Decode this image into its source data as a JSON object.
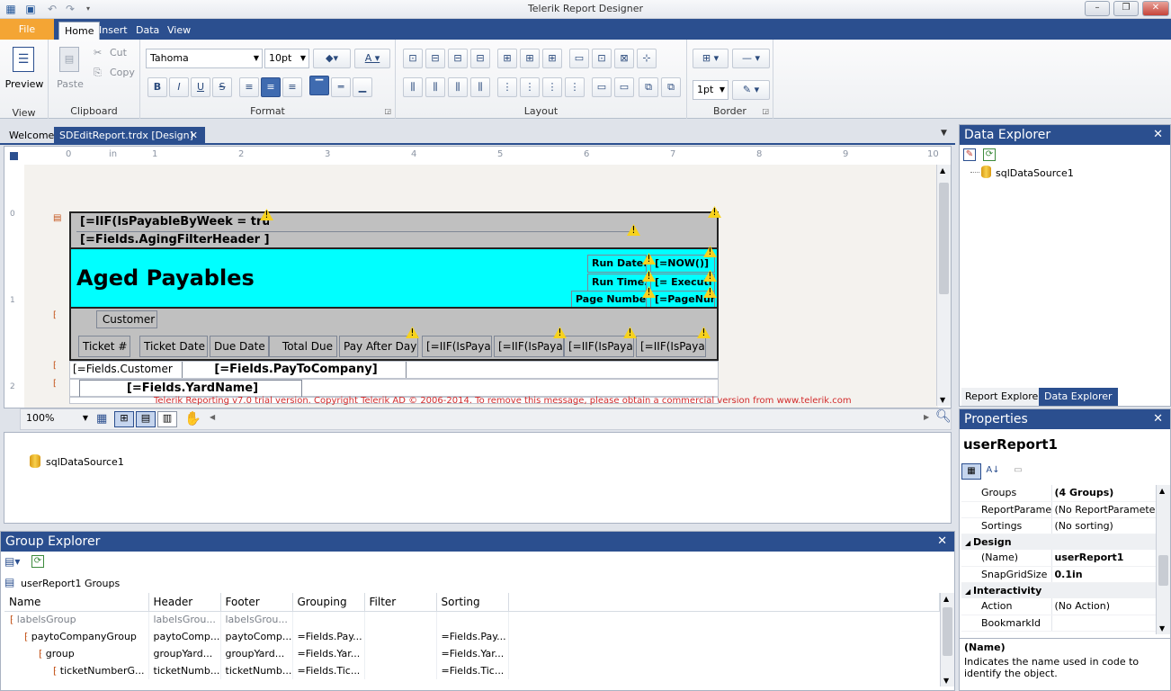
{
  "window": {
    "title": "Telerik Report Designer"
  },
  "ribbon": {
    "tabs": {
      "file": "File",
      "home": "Home",
      "insert": "Insert",
      "data": "Data",
      "view": "View"
    },
    "view_group": {
      "preview": "Preview",
      "label": "View"
    },
    "clipboard": {
      "paste": "Paste",
      "cut": "Cut",
      "copy": "Copy",
      "label": "Clipboard"
    },
    "format": {
      "font": "Tahoma",
      "size": "10pt",
      "label": "Format"
    },
    "layout": {
      "label": "Layout"
    },
    "border": {
      "width": "1pt",
      "label": "Border"
    }
  },
  "doc_tabs": {
    "welcome": "Welcome",
    "active": "SDEditReport.trdx [Design]"
  },
  "ruler": {
    "marks": [
      "0",
      "in",
      "1",
      "2",
      "3",
      "4",
      "5",
      "6",
      "7",
      "8",
      "9",
      "10"
    ]
  },
  "report": {
    "header_expr": "[=IIF(IsPayableByWeek = true",
    "aging_filter": "[=Fields.AgingFilterHeader ]",
    "title": "Aged Payables",
    "run_date_label": "Run Date:",
    "run_date_value": "[=NOW()]",
    "run_time_label": "Run Time:",
    "run_time_value": "[= Executi",
    "page_number_label": "Page Number:",
    "page_number_value": "[=PageNum",
    "customer_header": "Customer",
    "columns": [
      "Ticket #",
      "Ticket Date",
      "Due Date",
      "Total Due",
      "Pay After Day",
      "[=IIF(IsPaya",
      "[=IIF(IsPaya",
      "[=IIF(IsPaya",
      "[=IIF(IsPaya"
    ],
    "customer_field": "[=Fields.Customer",
    "pay_to_company": "[=Fields.PayToCompany]",
    "yard_name": "[=Fields.YardName]",
    "trial_notice": "Telerik Reporting v7.0 trial version. Copyright Telerik AD © 2006-2014. To remove this message, please obtain a commercial version from www.telerik.com"
  },
  "designer_toolbar": {
    "zoom": "100%"
  },
  "component_tray": {
    "item": "sqlDataSource1"
  },
  "data_explorer": {
    "title": "Data Explorer",
    "item": "sqlDataSource1",
    "tab_report": "Report Explorer",
    "tab_data": "Data Explorer"
  },
  "properties": {
    "title": "Properties",
    "object": "userReport1",
    "rows": [
      {
        "name": "Groups",
        "value": "(4 Groups)",
        "bold_value": true
      },
      {
        "name": "ReportParamet",
        "value": "(No ReportParameters"
      },
      {
        "name": "Sortings",
        "value": "(No sorting)"
      },
      {
        "category": "Design"
      },
      {
        "name": "(Name)",
        "value": "userReport1",
        "bold_value": true
      },
      {
        "name": "SnapGridSize",
        "value": "0.1in",
        "bold_value": true
      },
      {
        "category": "Interactivity"
      },
      {
        "name": "Action",
        "value": "(No Action)"
      },
      {
        "name": "BookmarkId",
        "value": ""
      }
    ],
    "desc_title": "(Name)",
    "desc_text": "Indicates the name used in code to identify the object."
  },
  "group_explorer": {
    "title": "Group Explorer",
    "root": "userReport1 Groups",
    "headers": [
      "Name",
      "Header",
      "Footer",
      "Grouping",
      "Filter",
      "Sorting"
    ],
    "rows": [
      {
        "name": "labelsGroup",
        "header": "labelsGrou...",
        "footer": "labelsGrou...",
        "grouping": "",
        "filter": "",
        "sorting": "",
        "muted": true
      },
      {
        "name": "paytoCompanyGroup",
        "header": "paytoComp...",
        "footer": "paytoComp...",
        "grouping": "=Fields.Pay...",
        "filter": "",
        "sorting": "=Fields.Pay..."
      },
      {
        "name": "group",
        "header": "groupYard...",
        "footer": "groupYard...",
        "grouping": "=Fields.Yar...",
        "filter": "",
        "sorting": "=Fields.Yar..."
      },
      {
        "name": "ticketNumberG...",
        "header": "ticketNumb...",
        "footer": "ticketNumb...",
        "grouping": "=Fields.Tic...",
        "filter": "",
        "sorting": "=Fields.Tic..."
      }
    ]
  },
  "colors": {
    "accent": "#2b4f8f",
    "file_tab": "#f4a534",
    "title_band": "#00ffff",
    "band_gray": "#c0c0c0",
    "trial_red": "#d22b2b"
  }
}
